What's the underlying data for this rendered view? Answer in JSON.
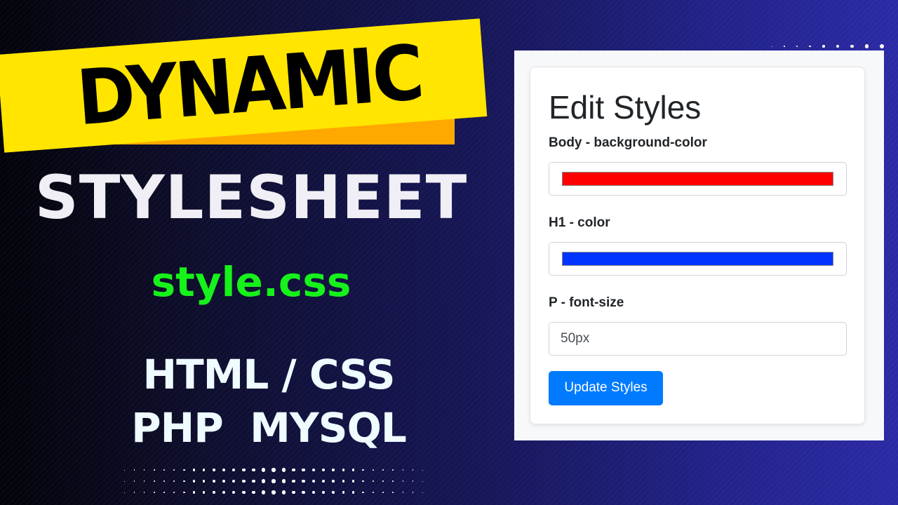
{
  "thumbnail": {
    "banner_text": "DYNAMIC",
    "title": "STYLESHEET",
    "file_name": "style.css",
    "tech_line_1": "HTML / CSS",
    "tech_line_2": "PHP  MYSQL",
    "colors": {
      "banner": "#ffe500",
      "banner_shadow": "#ffa800",
      "file_name": "#16f21a"
    }
  },
  "form": {
    "title": "Edit Styles",
    "fields": [
      {
        "label": "Body - background-color",
        "type": "color",
        "value": "#ff0000"
      },
      {
        "label": "H1 - color",
        "type": "color",
        "value": "#0033ff"
      },
      {
        "label": "P - font-size",
        "type": "text",
        "value": "50px"
      }
    ],
    "submit_label": "Update Styles",
    "accent": "#007bff"
  }
}
